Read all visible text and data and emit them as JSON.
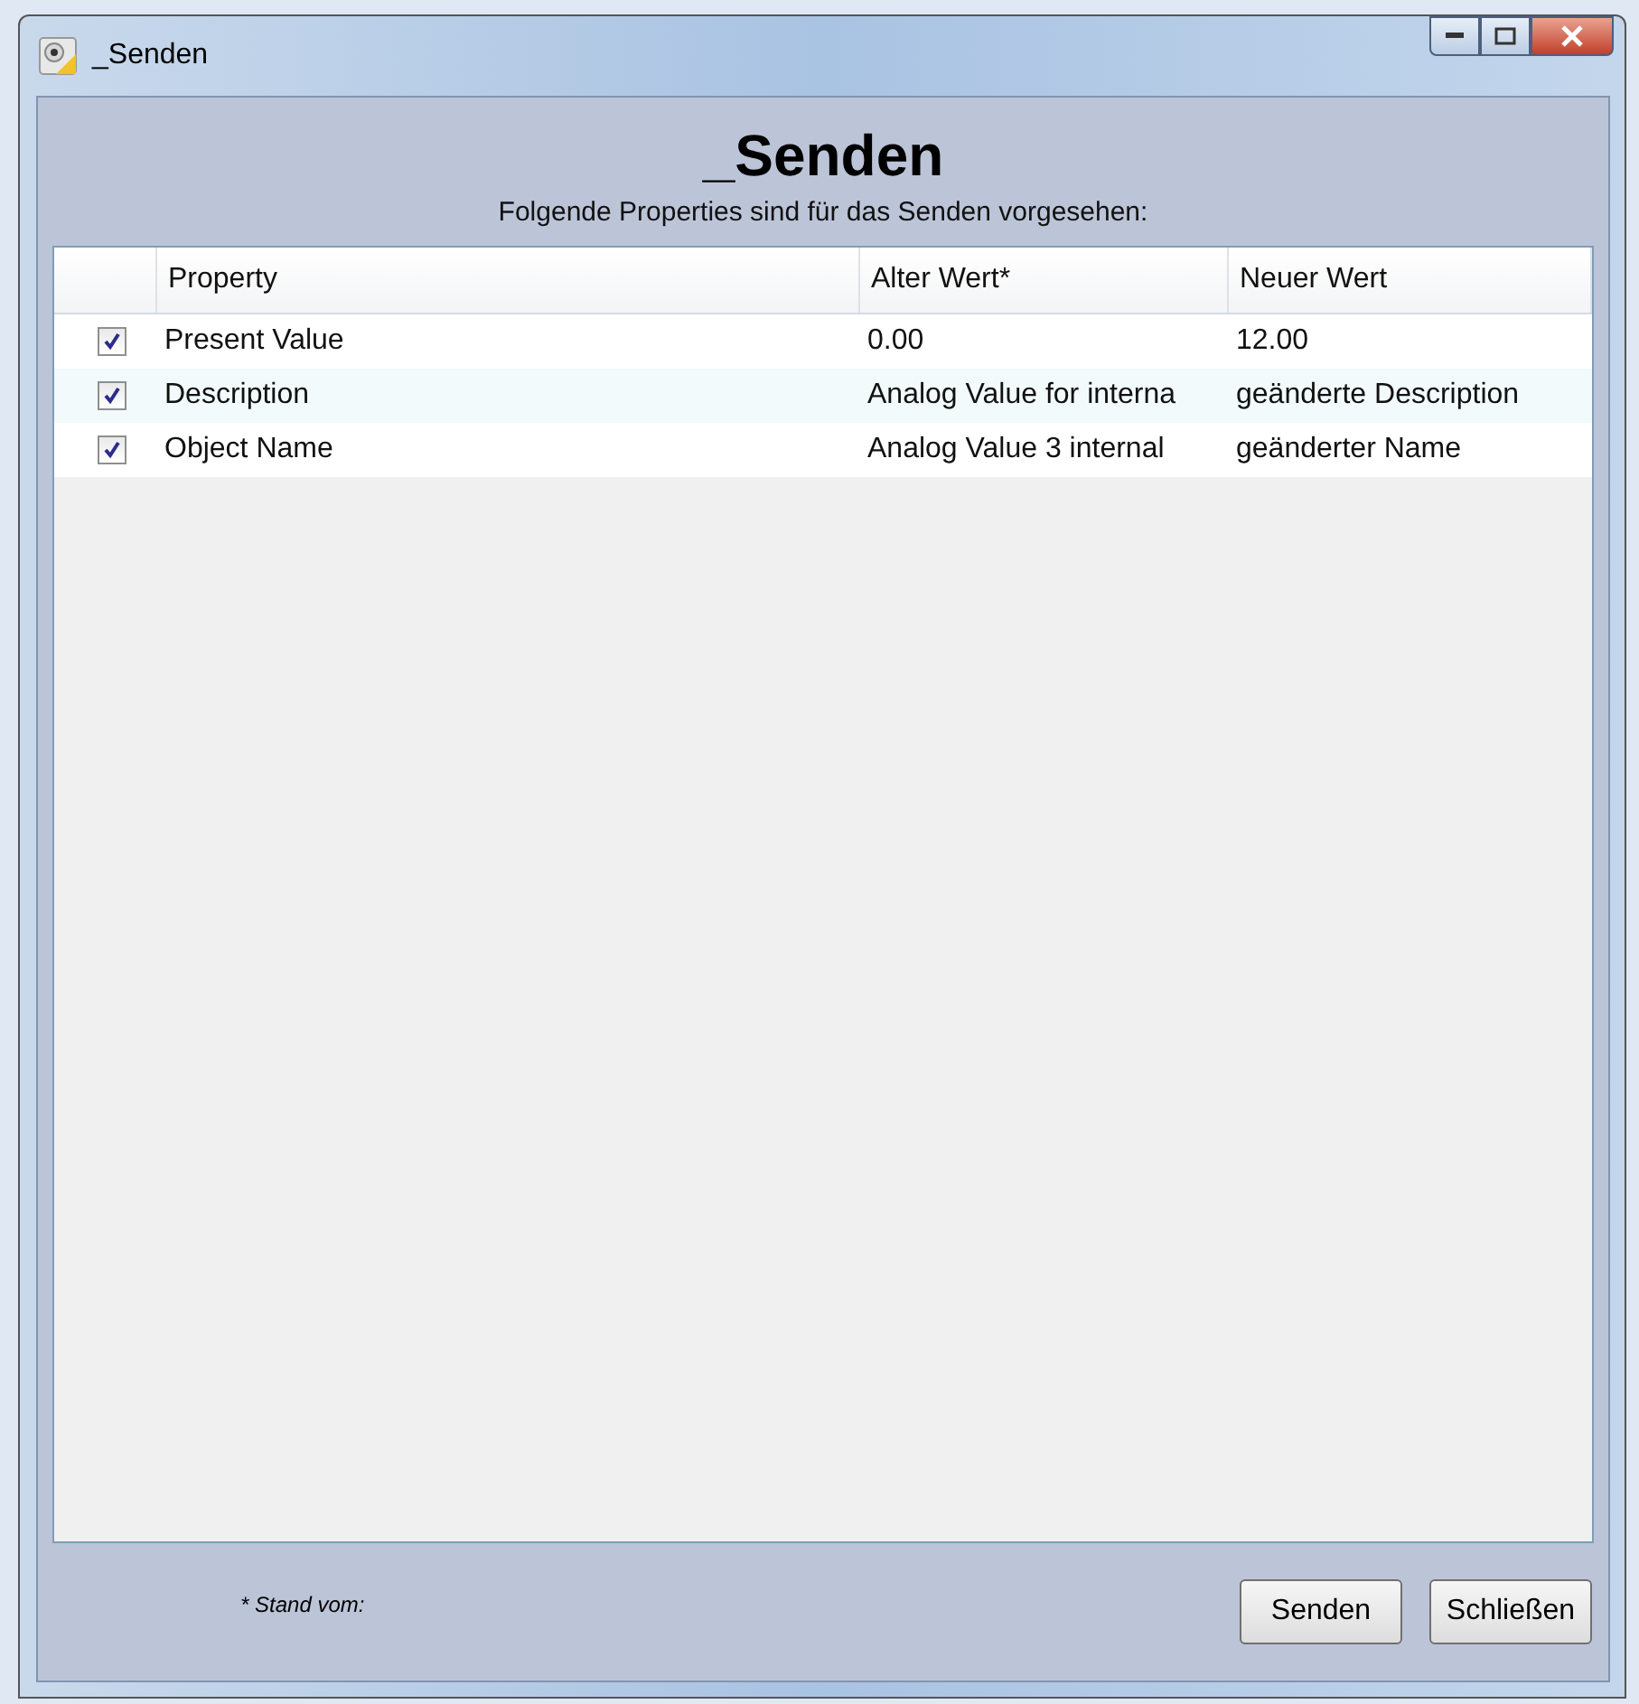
{
  "window": {
    "title": "_Senden"
  },
  "heading": "_Senden",
  "subtitle": "Folgende Properties sind für das Senden vorgesehen:",
  "table": {
    "columns": [
      "Property",
      "Alter Wert*",
      "Neuer Wert"
    ],
    "rows": [
      {
        "checked": true,
        "cells": [
          "Present Value",
          "0.00",
          "12.00"
        ]
      },
      {
        "checked": true,
        "cells": [
          "Description",
          "Analog Value for interna",
          "geänderte Description"
        ]
      },
      {
        "checked": true,
        "cells": [
          "Object Name",
          "Analog Value 3 internal",
          "geänderter Name"
        ]
      }
    ]
  },
  "footnote": "* Stand vom:",
  "buttons": [
    "Senden",
    "Schließen"
  ]
}
